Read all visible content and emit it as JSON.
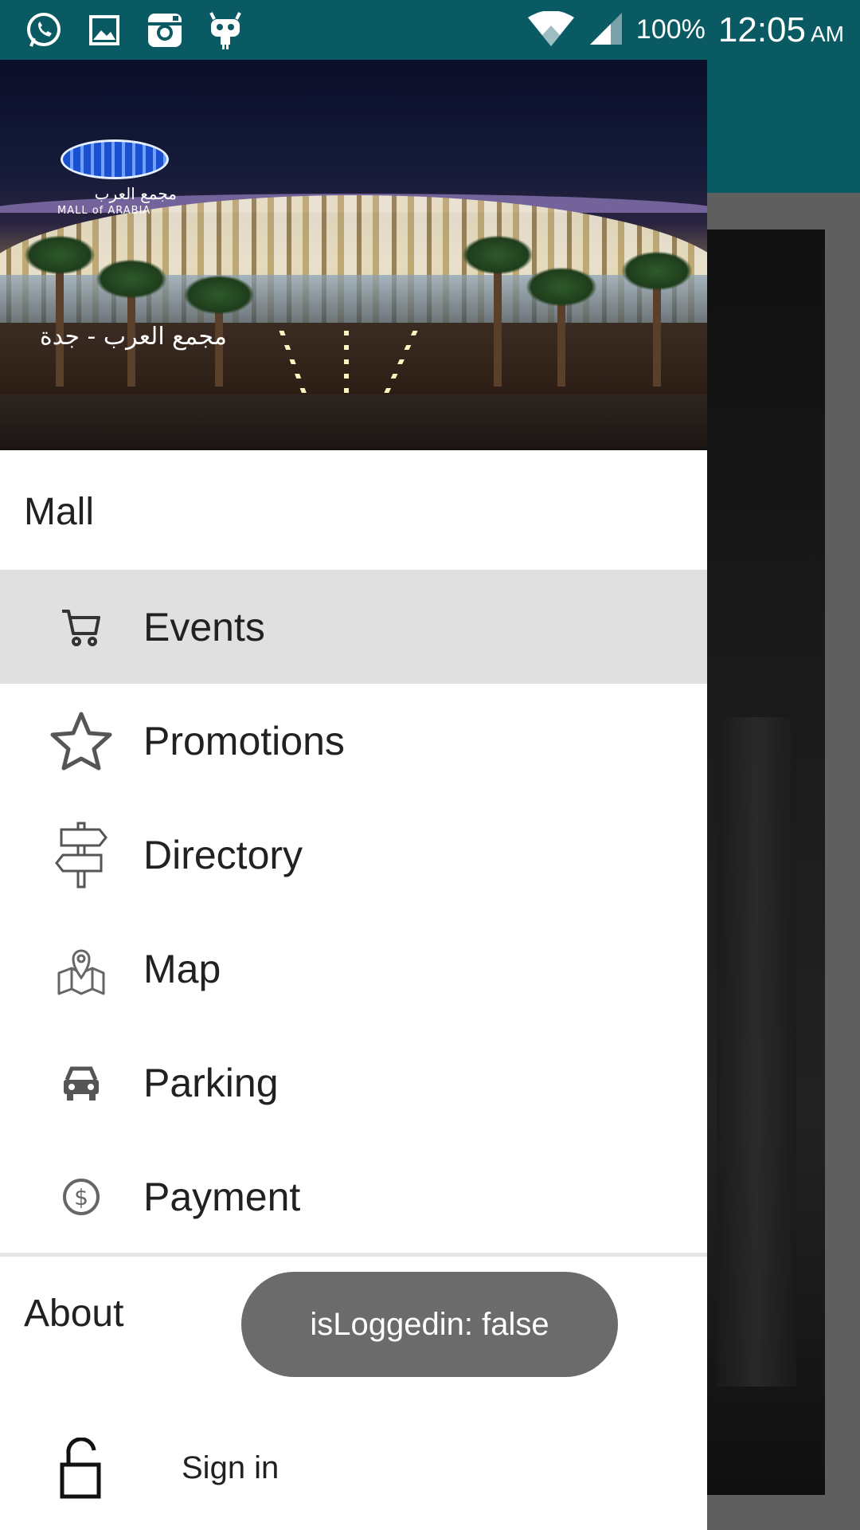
{
  "status_bar": {
    "left_icons": [
      "whatsapp-icon",
      "gallery-icon",
      "instagram-icon",
      "cyanogen-icon"
    ],
    "battery": "100%",
    "time": "12:05",
    "ampm": "AM",
    "color": "#0a5a63"
  },
  "drawer": {
    "header": {
      "logo_text": "مجمع العرب",
      "logo_sub": "MALL of ARABIA",
      "title": "مجمع العرب - جدة"
    },
    "sections": [
      {
        "label": "Mall",
        "items": [
          {
            "label": "Events",
            "icon": "cart-icon",
            "active": true
          },
          {
            "label": "Promotions",
            "icon": "star-icon",
            "active": false
          },
          {
            "label": "Directory",
            "icon": "signpost-icon",
            "active": false
          },
          {
            "label": "Map",
            "icon": "map-icon",
            "active": false
          },
          {
            "label": "Parking",
            "icon": "car-icon",
            "active": false
          },
          {
            "label": "Payment",
            "icon": "dollar-coin-icon",
            "active": false
          }
        ]
      },
      {
        "label": "About"
      }
    ],
    "signin": {
      "label": "Sign in",
      "icon": "unlock-icon"
    }
  },
  "toast": {
    "text": "isLoggedin: false"
  },
  "colors": {
    "active_item_bg": "#e0e0e0",
    "toast_bg": "#6b6b6b"
  }
}
